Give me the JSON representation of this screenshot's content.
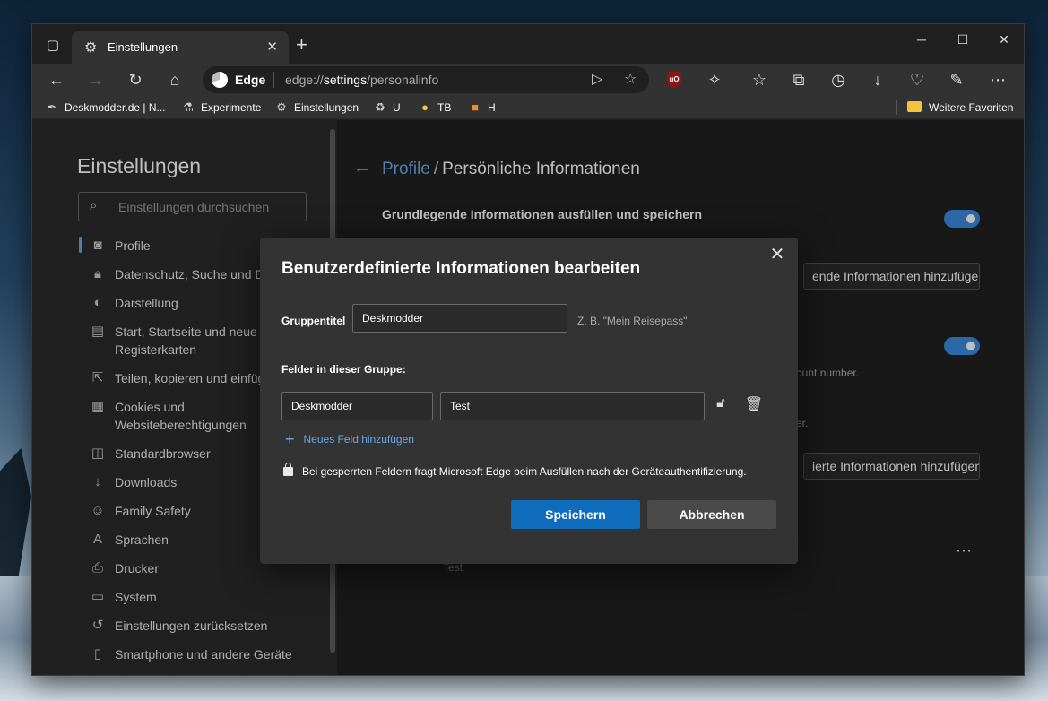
{
  "tab": {
    "title": "Einstellungen"
  },
  "address": {
    "brand": "Edge",
    "url_prefix": "edge://",
    "url_bold": "settings",
    "url_suffix": "/personalinfo"
  },
  "favorites": [
    {
      "label": "Deskmodder.de | N..."
    },
    {
      "label": "Experimente"
    },
    {
      "label": "Einstellungen"
    },
    {
      "label": "U"
    },
    {
      "label": "TB"
    },
    {
      "label": "H"
    }
  ],
  "favorites_folder": "Weitere Favoriten",
  "extension_ublock": "uO",
  "sidebar": {
    "title": "Einstellungen",
    "search_placeholder": "Einstellungen durchsuchen",
    "items": [
      {
        "label": "Profile",
        "icon": "profile-icon"
      },
      {
        "label": "Datenschutz, Suche und Dienste",
        "icon": "lock-icon"
      },
      {
        "label": "Darstellung",
        "icon": "palette-icon"
      },
      {
        "label": "Start, Startseite und neue",
        "label2": "Registerkarten",
        "icon": "newtab-icon"
      },
      {
        "label": "Teilen, kopieren und einfügen",
        "icon": "share-icon"
      },
      {
        "label": "Cookies und",
        "label2": "Websiteberechtigungen",
        "icon": "cookie-icon"
      },
      {
        "label": "Standardbrowser",
        "icon": "browser-icon"
      },
      {
        "label": "Downloads",
        "icon": "download-icon"
      },
      {
        "label": "Family Safety",
        "icon": "family-icon"
      },
      {
        "label": "Sprachen",
        "icon": "language-icon"
      },
      {
        "label": "Drucker",
        "icon": "printer-icon"
      },
      {
        "label": "System",
        "icon": "laptop-icon"
      },
      {
        "label": "Einstellungen zurücksetzen",
        "icon": "reset-icon"
      },
      {
        "label": "Smartphone und andere Geräte",
        "icon": "phone-icon"
      }
    ]
  },
  "main": {
    "crumb_link": "Profile",
    "crumb_sep": "/",
    "crumb_current": "Persönliche Informationen",
    "section_title": "Grundlegende Informationen ausfüllen und speichern",
    "btn_add_basic": "ende Informationen hinzufügen",
    "peek_account": "ount number.",
    "peek_er": "er.",
    "btn_add_custom": "ierte Informationen hinzufügen",
    "peek_test": "Test"
  },
  "modal": {
    "title": "Benutzerdefinierte Informationen bearbeiten",
    "group_label": "Gruppentitel",
    "group_value": "Deskmodder",
    "group_hint": "Z. B. \"Mein Reisepass\"",
    "fields_label": "Felder in dieser Gruppe:",
    "field_name": "Deskmodder",
    "field_value": "Test",
    "add_field": "Neues Feld hinzufügen",
    "note": "Bei gesperrten Feldern fragt Microsoft Edge beim Ausfüllen nach der Geräteauthentifizierung.",
    "save": "Speichern",
    "cancel": "Abbrechen"
  }
}
